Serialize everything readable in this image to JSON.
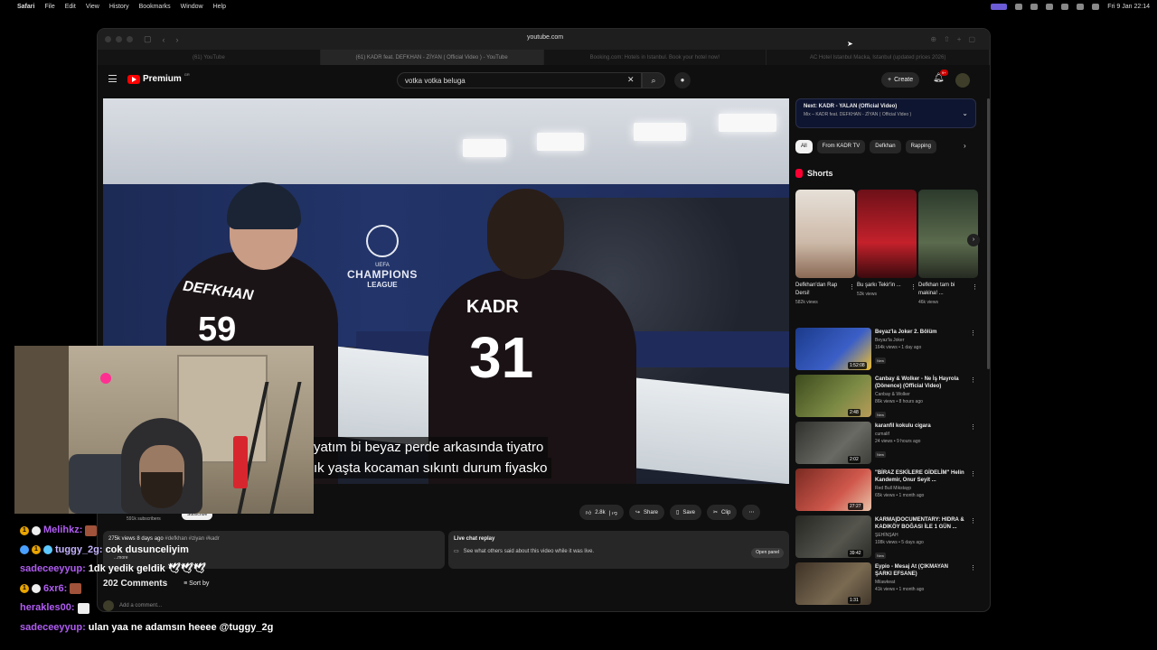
{
  "menubar": {
    "app": "Safari",
    "items": [
      "File",
      "Edit",
      "View",
      "History",
      "Bookmarks",
      "Window",
      "Help"
    ],
    "clock": "Fri 9 Jan  22:14"
  },
  "browser": {
    "url": "youtube.com",
    "tabs": [
      {
        "label": "(61) YouTube"
      },
      {
        "label": "(61) KADR feat. DEFKHAN - ZİYAN ( Official Video ) - YouTube"
      },
      {
        "label": "Booking.com: Hotels in Istanbul. Book your hotel now!"
      },
      {
        "label": "AC Hotel Istanbul Macka, Istanbul (updated prices 2026)"
      }
    ]
  },
  "youtube": {
    "logo_text": "Premium",
    "region": "GR",
    "search_value": "votka votka beluga",
    "create_label": "Create",
    "notif_badge": "9+"
  },
  "video": {
    "shirt_name_left": "DEFKHAN",
    "shirt_num_left": "59",
    "shirt_name_right": "KADR",
    "shirt_num_right": "31",
    "uefa_top": "UEFA",
    "uefa_line1": "CHAMPIONS",
    "uefa_line2": "LEAGUE",
    "subtitle_1": "yatım bi beyaz perde arkasında tiyatro",
    "subtitle_2": "ık yaşta kocaman sıkıntı durum fiyasko"
  },
  "actions": {
    "likes": "2.8k",
    "share": "Share",
    "save": "Save",
    "clip": "Clip"
  },
  "channel": {
    "subscribers": "591k subscribers",
    "subscribe": "Subscribe"
  },
  "description": {
    "stats": "275k views  8 days ago",
    "tags": "#defkhan #ziyan #kadr",
    "more": "...more"
  },
  "live_replay": {
    "title": "Live chat replay",
    "text": "See what others said about this video while it was live.",
    "button": "Open panel"
  },
  "comments": {
    "count": "202 Comments",
    "sort": "Sort by",
    "add": "Add a comment..."
  },
  "upnext": {
    "title": "Next: KADR - YALAN (Official Video)",
    "subtitle": "Mix – KADR feat. DEFKHAN - ZİYAN ( Official Video )"
  },
  "chips": [
    "All",
    "From KADR TV",
    "Defkhan",
    "Rapping"
  ],
  "shorts": {
    "heading": "Shorts",
    "items": [
      {
        "title": "Defkhan'dan Rap Dersi!",
        "views": "582k views",
        "color": "#d9c6b8"
      },
      {
        "title": "Bu şarkı Tekir'in ...",
        "views": "53k views",
        "color": "#b3202a"
      },
      {
        "title": "Defkhan tam bi makina! ...",
        "views": "46k views",
        "color": "#3f4a3a"
      }
    ]
  },
  "videos": [
    {
      "title": "Beyaz'la Joker 2. Bölüm",
      "channel": "Beyaz'la Joker",
      "views": "164k views • 1 day ago",
      "duration": "1:52:08",
      "new": "New",
      "color": "#1b3a8a"
    },
    {
      "title": "Canbay & Wolker - Ne İş Hayrola (Dönence) (Official Video)",
      "channel": "Canbay & Wolker",
      "views": "86k views • 8 hours ago",
      "duration": "2:48",
      "new": "New",
      "color": "#5b6a2e"
    },
    {
      "title": "karanfil kokulu cigara",
      "channel": "cumalif",
      "views": "24 views • 9 hours ago",
      "duration": "2:02",
      "new": "New",
      "color": "#4b4b48"
    },
    {
      "title": "\"BİRAZ ESKİLERE GİDELİM\" Helin Kandemir, Onur Seyit ...",
      "channel": "Red Bull Mikstayp",
      "views": "65k views • 1 month ago",
      "duration": "27:27",
      "new": "",
      "color": "#b0463c"
    },
    {
      "title": "KARMA|DOCUMENTARY: HIDRA & KADIKÖY BOĞASI İLE 1 GÜN ...",
      "channel": "ŞEHİNŞAH",
      "views": "108k views • 5 days ago",
      "duration": "39:42",
      "new": "New",
      "color": "#3a3a36"
    },
    {
      "title": "Eypio - Mesaj At (ÇIKMAYAN ŞARKI EFSANE)",
      "channel": "Milawkeat",
      "views": "41k views • 1 month ago",
      "duration": "1:31",
      "new": "",
      "color": "#5a4a36"
    }
  ],
  "chat": [
    {
      "user": "Melihkz:",
      "msg": "",
      "badges": true,
      "emote": true
    },
    {
      "user": "tuggy_2g:",
      "msg": "cok dusunceliyim",
      "badges": true,
      "emote": false
    },
    {
      "user": "sadeceeyyup:",
      "msg": "1dk yedik geldik 🕊🕊🕊",
      "badges": false,
      "emote": false
    },
    {
      "user": "6xr6:",
      "msg": "",
      "badges": true,
      "emote": true
    },
    {
      "user": "herakles00:",
      "msg": "",
      "badges": false,
      "emote": true
    },
    {
      "user": "sadeceeyyup:",
      "msg": "ulan yaa ne adamsın heeee @tuggy_2g",
      "badges": false,
      "emote": false
    }
  ]
}
